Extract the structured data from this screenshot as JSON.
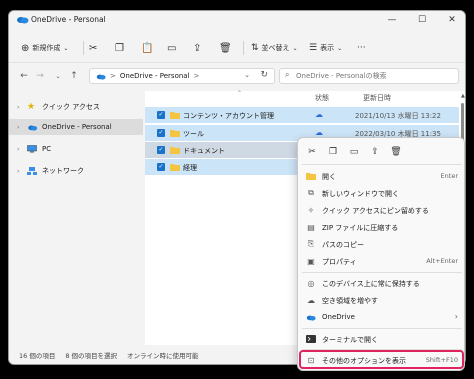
{
  "window": {
    "title": "OneDrive - Personal"
  },
  "toolbar": {
    "new_label": "新規作成",
    "sort_label": "並べ替え",
    "view_label": "表示",
    "more": "···"
  },
  "address": {
    "path": "OneDrive - Personal",
    "separator": ">",
    "search_placeholder": "OneDrive - Personalの検索"
  },
  "sidebar": {
    "items": [
      {
        "label": "クイック アクセス",
        "icon": "star-icon"
      },
      {
        "label": "OneDrive - Personal",
        "icon": "cloud-icon",
        "selected": true
      },
      {
        "label": "PC",
        "icon": "pc-icon"
      },
      {
        "label": "ネットワーク",
        "icon": "network-icon"
      }
    ]
  },
  "list": {
    "columns": {
      "status": "状態",
      "modified": "更新日時"
    },
    "rows": [
      {
        "name": "コンテンツ・アカウント管理",
        "date": "2021/10/13 水曜日 13:22"
      },
      {
        "name": "ツール",
        "date": "2022/03/10 木曜日 11:35"
      },
      {
        "name": "ドキュメント",
        "date": ""
      },
      {
        "name": "経理",
        "date": ""
      }
    ]
  },
  "status": {
    "count": "16 個の項目",
    "selected": "8 個の項目を選択",
    "online": "オンライン時に使用可能"
  },
  "menu": {
    "items": [
      {
        "label": "開く",
        "key": "Enter",
        "icon": "open-icon"
      },
      {
        "label": "新しいウィンドウで開く",
        "key": "",
        "icon": "new-window-icon"
      },
      {
        "label": "クイック アクセスにピン留めする",
        "key": "",
        "icon": "pin-icon"
      },
      {
        "label": "ZIP ファイルに圧縮する",
        "key": "",
        "icon": "zip-icon"
      },
      {
        "label": "パスのコピー",
        "key": "",
        "icon": "copy-path-icon"
      },
      {
        "label": "プロパティ",
        "key": "Alt+Enter",
        "icon": "properties-icon"
      },
      {
        "label": "このデバイス上に常に保持する",
        "key": "",
        "icon": "keep-icon"
      },
      {
        "label": "空き領域を増やす",
        "key": "",
        "icon": "free-space-icon"
      },
      {
        "label": "OneDrive",
        "key": "",
        "icon": "onedrive-icon"
      },
      {
        "label": "ターミナルで開く",
        "key": "",
        "icon": "terminal-icon"
      },
      {
        "label": "その他のオプションを表示",
        "key": "Shift+F10",
        "icon": "more-options-icon"
      }
    ]
  },
  "colors": {
    "accent": "#1a73c8",
    "selection": "#cce4f7",
    "highlight": "#e0245e",
    "folder": "#f4c542"
  }
}
